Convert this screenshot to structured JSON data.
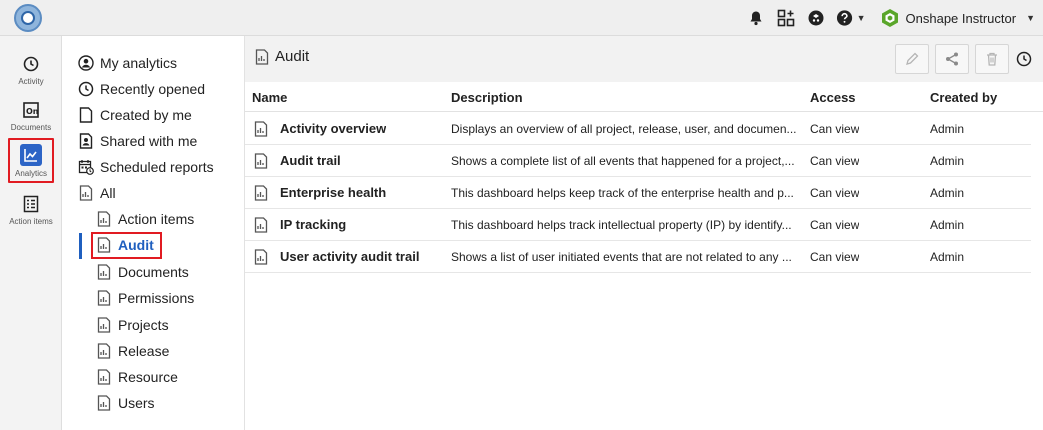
{
  "topbar": {
    "user_label": "Onshape Instructor"
  },
  "rail": {
    "items": [
      {
        "label": "Activity",
        "icon": "clock-icon"
      },
      {
        "label": "Documents",
        "icon": "documents-icon"
      },
      {
        "label": "Analytics",
        "icon": "analytics-icon"
      },
      {
        "label": "Action items",
        "icon": "checklist-icon"
      }
    ]
  },
  "nav": {
    "items": [
      {
        "label": "My analytics",
        "icon": "user-circle-icon"
      },
      {
        "label": "Recently opened",
        "icon": "clock-icon"
      },
      {
        "label": "Created by me",
        "icon": "document-icon"
      },
      {
        "label": "Shared with me",
        "icon": "shared-user-icon"
      },
      {
        "label": "Scheduled reports",
        "icon": "calendar-icon"
      },
      {
        "label": "All",
        "icon": "report-icon"
      },
      {
        "label": "Action items",
        "icon": "report-icon"
      },
      {
        "label": "Audit",
        "icon": "report-icon"
      },
      {
        "label": "Documents",
        "icon": "report-icon"
      },
      {
        "label": "Permissions",
        "icon": "report-icon"
      },
      {
        "label": "Projects",
        "icon": "report-icon"
      },
      {
        "label": "Release",
        "icon": "report-icon"
      },
      {
        "label": "Resource",
        "icon": "report-icon"
      },
      {
        "label": "Users",
        "icon": "report-icon"
      }
    ]
  },
  "main": {
    "title": "Audit",
    "columns": [
      "Name",
      "Description",
      "Access",
      "Created by"
    ],
    "rows": [
      {
        "name": "Activity overview",
        "description": "Displays an overview of all project, release, user, and documen...",
        "access": "Can view",
        "created_by": "Admin"
      },
      {
        "name": "Audit trail",
        "description": "Shows a complete list of all events that happened for a project,...",
        "access": "Can view",
        "created_by": "Admin"
      },
      {
        "name": "Enterprise health",
        "description": "This dashboard helps keep track of the enterprise health and p...",
        "access": "Can view",
        "created_by": "Admin"
      },
      {
        "name": "IP tracking",
        "description": "This dashboard helps track intellectual property (IP) by identify...",
        "access": "Can view",
        "created_by": "Admin"
      },
      {
        "name": "User activity audit trail",
        "description": "Shows a list of user initiated events that are not related to any ...",
        "access": "Can view",
        "created_by": "Admin"
      }
    ]
  },
  "colors": {
    "accent": "#1f5fbf",
    "highlight_box": "#e11b22",
    "onshape_green": "#5aa62a"
  }
}
